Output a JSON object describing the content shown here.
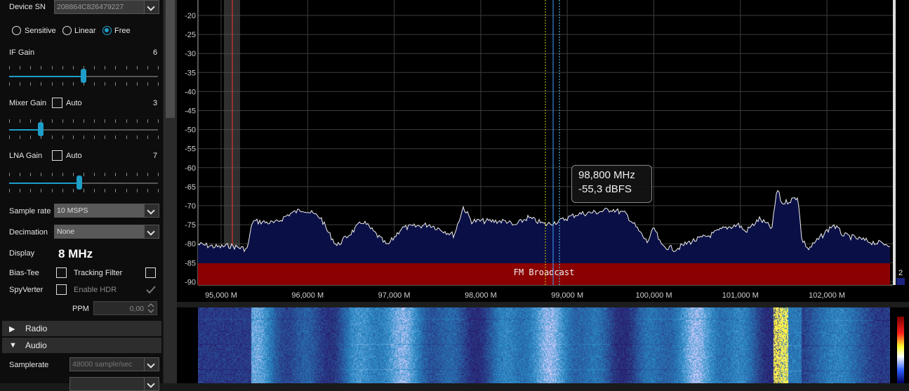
{
  "source": {
    "device_sn_label": "Device SN",
    "device_sn_value": "208864C826479227",
    "modes": [
      "Sensitive",
      "Linear",
      "Free"
    ],
    "selected_mode": "Free",
    "if_gain": {
      "label": "IF Gain",
      "value": "6",
      "level": 0.5
    },
    "mixer_gain": {
      "label": "Mixer Gain",
      "auto_label": "Auto",
      "value": "3",
      "level": 0.21
    },
    "lna_gain": {
      "label": "LNA Gain",
      "auto_label": "Auto",
      "value": "7",
      "level": 0.47
    },
    "sample_rate": {
      "label": "Sample rate",
      "value": "10 MSPS"
    },
    "decimation": {
      "label": "Decimation",
      "value": "None"
    },
    "display": {
      "label": "Display",
      "value": "8 MHz"
    },
    "bias_tee_label": "Bias-Tee",
    "tracking_filter_label": "Tracking Filter",
    "spyverter_label": "SpyVerter",
    "enable_hdr_label": "Enable HDR",
    "ppm": {
      "label": "PPM",
      "value": "0,00"
    }
  },
  "sections": {
    "radio": "Radio",
    "audio": "Audio"
  },
  "audio": {
    "samplerate_label": "Samplerate",
    "samplerate_value": "48000 sample/sec"
  },
  "spectrum": {
    "y_ticks": [
      "-20",
      "-25",
      "-30",
      "-35",
      "-40",
      "-45",
      "-50",
      "-55",
      "-60",
      "-65",
      "-70",
      "-75",
      "-80",
      "-85",
      "-90"
    ],
    "x_ticks": [
      "95,000 M",
      "96,000 M",
      "97,000 M",
      "98,000 M",
      "99,000 M",
      "100,000 M",
      "101,000 M",
      "102,000 M"
    ],
    "band_label": "FM Broadcast",
    "band_color": "#8b0000",
    "cursor_freq": "98,800 MHz",
    "cursor_level": "-55,3 dBFS",
    "right_marker": "2",
    "accent": "#1e9ec8"
  }
}
